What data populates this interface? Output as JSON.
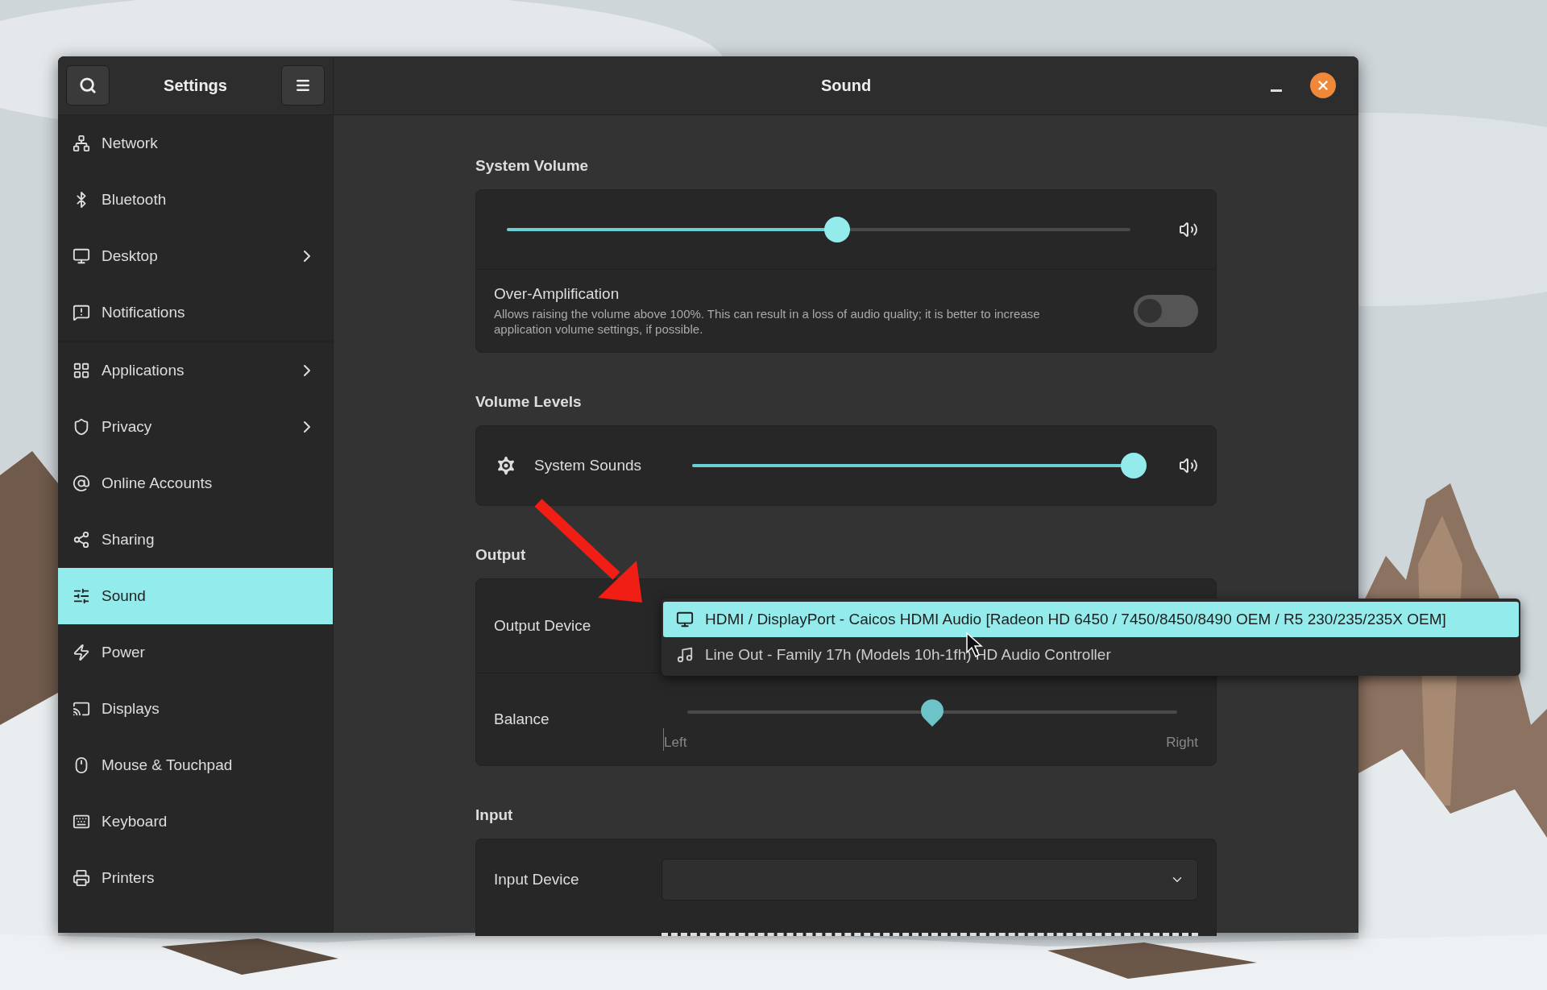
{
  "sidebar": {
    "title": "Settings",
    "sections": [
      {
        "items": [
          {
            "label": "Network",
            "selected": false,
            "submenu": false
          },
          {
            "label": "Bluetooth",
            "selected": false,
            "submenu": false
          },
          {
            "label": "Desktop",
            "selected": false,
            "submenu": true
          },
          {
            "label": "Notifications",
            "selected": false,
            "submenu": false
          }
        ]
      },
      {
        "items": [
          {
            "label": "Applications",
            "selected": false,
            "submenu": true
          },
          {
            "label": "Privacy",
            "selected": false,
            "submenu": true
          },
          {
            "label": "Online Accounts",
            "selected": false,
            "submenu": false
          },
          {
            "label": "Sharing",
            "selected": false,
            "submenu": false
          },
          {
            "label": "Sound",
            "selected": true,
            "submenu": false
          },
          {
            "label": "Power",
            "selected": false,
            "submenu": false
          },
          {
            "label": "Displays",
            "selected": false,
            "submenu": false
          },
          {
            "label": "Mouse & Touchpad",
            "selected": false,
            "submenu": false
          },
          {
            "label": "Keyboard",
            "selected": false,
            "submenu": false
          },
          {
            "label": "Printers",
            "selected": false,
            "submenu": false
          }
        ]
      }
    ]
  },
  "window": {
    "title": "Sound"
  },
  "system_volume": {
    "heading": "System Volume",
    "level": 0.53,
    "over_amplification": {
      "label": "Over-Amplification",
      "description": "Allows raising the volume above 100%. This can result in a loss of audio quality; it is better to increase application volume settings, if possible.",
      "on": false
    }
  },
  "volume_levels": {
    "heading": "Volume Levels",
    "items": [
      {
        "label": "System Sounds",
        "level": 1.0
      }
    ]
  },
  "output": {
    "heading": "Output",
    "device_label": "Output Device",
    "dropdown": {
      "expanded": true,
      "options": [
        {
          "label": "HDMI / DisplayPort - Caicos HDMI Audio [Radeon HD 6450 / 7450/8450/8490 OEM / R5 230/235/235X OEM]",
          "selected": true,
          "kind": "display"
        },
        {
          "label": "Line Out - Family 17h (Models 10h-1fh) HD Audio Controller",
          "selected": false,
          "kind": "audio"
        }
      ]
    },
    "balance": {
      "label": "Balance",
      "level": 0.5,
      "left": "Left",
      "right": "Right"
    }
  },
  "input": {
    "heading": "Input",
    "device_label": "Input Device"
  }
}
